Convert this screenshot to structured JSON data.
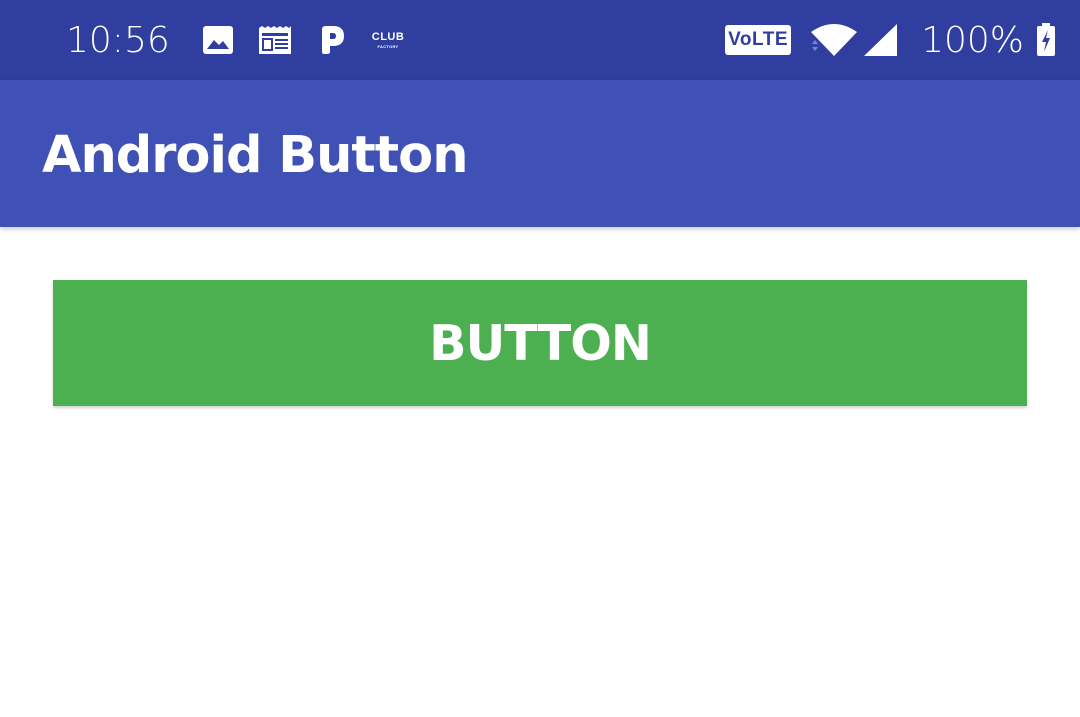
{
  "status_bar": {
    "time": "10:56",
    "notification_icons": [
      "image-icon",
      "news-icon",
      "paytm-p-icon",
      "club-factory-icon"
    ],
    "club_factory": {
      "line1": "CLUB",
      "line2": "FACTORY"
    },
    "volte_label": "VoLTE",
    "battery_percent": "100%",
    "colors": {
      "background": "#303f9f",
      "foreground": "#ffffff"
    }
  },
  "app_bar": {
    "title": "Android Button",
    "color": "#3f51b5"
  },
  "main": {
    "button_label": "BUTTON",
    "button_color": "#4caf50"
  }
}
